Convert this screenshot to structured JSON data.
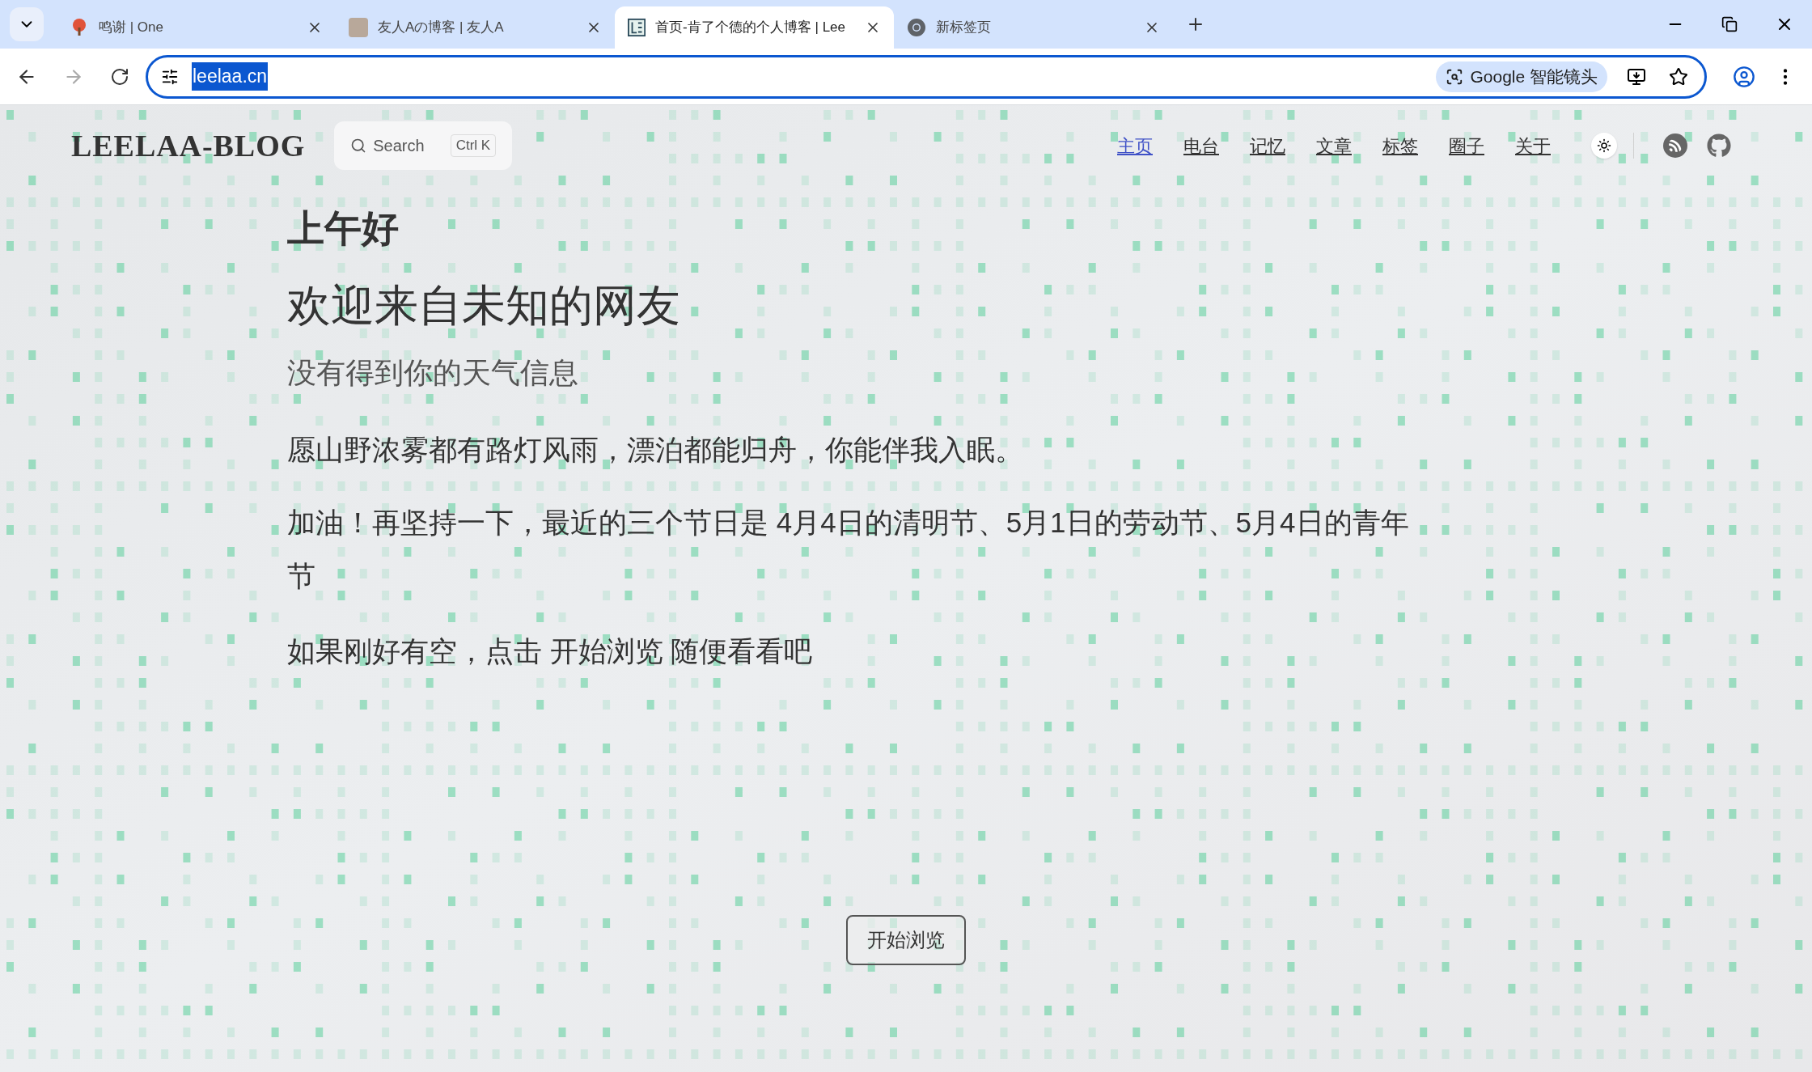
{
  "browser": {
    "tabs": [
      {
        "title": "鸣谢 | One",
        "selected": false,
        "kind": "tree"
      },
      {
        "title": "友人Aの博客 | 友人A",
        "selected": false,
        "kind": "avatar"
      },
      {
        "title": "首页-肯了个德的个人博客 | Lee",
        "selected": true,
        "kind": "logo"
      },
      {
        "title": "新标签页",
        "selected": false,
        "kind": "chrome"
      }
    ],
    "url": "leelaa.cn",
    "lens": "Google 智能镜头"
  },
  "page": {
    "logo": "LEELAA-BLOG",
    "search": {
      "placeholder": "Search",
      "shortcut": "Ctrl K"
    },
    "nav": [
      {
        "label": "主页",
        "selected": true
      },
      {
        "label": "电台",
        "selected": false
      },
      {
        "label": "记忆",
        "selected": false
      },
      {
        "label": "文章",
        "selected": false
      },
      {
        "label": "标签",
        "selected": false
      },
      {
        "label": "圈子",
        "selected": false
      },
      {
        "label": "关于",
        "selected": false
      }
    ],
    "greeting": "上午好",
    "welcome": "欢迎来自未知的网友",
    "weather": "没有得到你的天气信息",
    "quote": "愿山野浓雾都有路灯风雨，漂泊都能归舟，你能伴我入眠。",
    "holidays": "加油！再坚持一下，最近的三个节日是 4月4日的清明节、5月1日的劳动节、5月4日的青年节",
    "invite": "如果刚好有空，点击 开始浏览 随便看看吧",
    "button": "开始浏览"
  }
}
